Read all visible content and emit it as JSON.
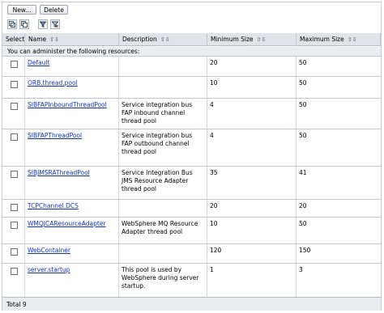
{
  "toolbar": {
    "new_label": "New...",
    "delete_label": "Delete",
    "icons": [
      "select-all-icon",
      "deselect-all-icon",
      "show-filter-icon",
      "clear-filter-icon"
    ]
  },
  "table": {
    "headers": {
      "select": "Select",
      "name": "Name",
      "description": "Description",
      "min": "Minimum Size",
      "max": "Maximum Size"
    },
    "banner": "You can administer the following resources:",
    "rows": [
      {
        "name": "Default",
        "description": "",
        "min": "20",
        "max": "50"
      },
      {
        "name": "ORB.thread.pool",
        "description": "",
        "min": "10",
        "max": "50"
      },
      {
        "name": "SIBFAPInboundThreadPool",
        "description": "Service integration bus FAP inbound channel thread pool",
        "min": "4",
        "max": "50"
      },
      {
        "name": "SIBFAPThreadPool",
        "description": "Service integration bus FAP outbound channel thread pool",
        "min": "4",
        "max": "50"
      },
      {
        "name": "SIBJMSRAThreadPool",
        "description": "Service Integration Bus JMS Resource Adapter thread pool",
        "min": "35",
        "max": "41"
      },
      {
        "name": "TCPChannel.DCS",
        "description": "",
        "min": "20",
        "max": "20"
      },
      {
        "name": "WMQJCAResourceAdapter",
        "description": "WebSphere MQ Resource Adapter thread pool",
        "min": "10",
        "max": "50"
      },
      {
        "name": "WebContainer",
        "description": "",
        "min": "120",
        "max": "150"
      },
      {
        "name": "server.startup",
        "description": "This pool is used by WebSphere during server startup.",
        "min": "1",
        "max": "3"
      }
    ],
    "total": "Total 9"
  },
  "colors": {
    "link": "#1233c8",
    "header_bg": "#dfe4ea",
    "banner_bg": "#e8edf2"
  }
}
